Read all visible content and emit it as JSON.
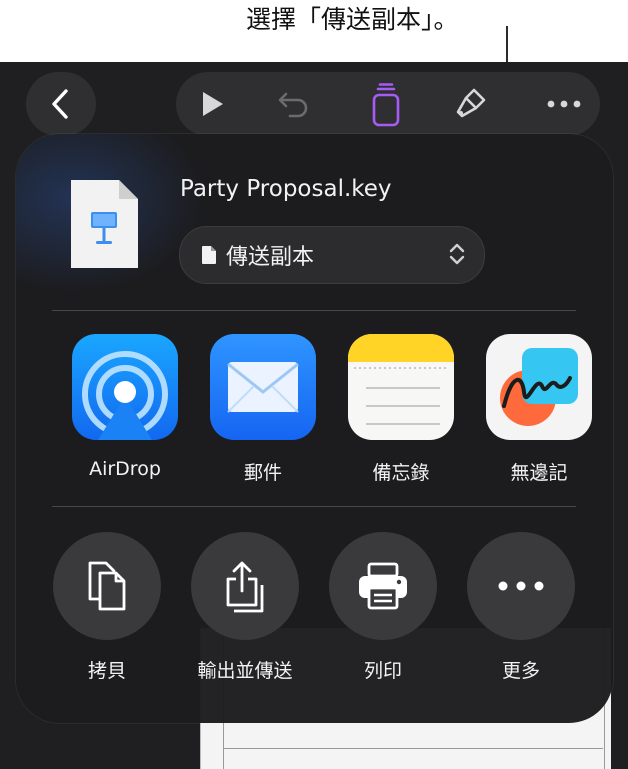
{
  "callout": {
    "text": "選擇「傳送副本」。"
  },
  "toolbar": {
    "icons": [
      "back-icon",
      "play-icon",
      "undo-icon",
      "collaborate-icon",
      "format-brush-icon",
      "more-icon"
    ],
    "accent_color": "#a45cf5"
  },
  "share_sheet": {
    "file_name": "Party Proposal.key",
    "send_option": {
      "label": "傳送副本"
    },
    "apps": [
      {
        "label": "AirDrop",
        "icon": "airdrop-icon"
      },
      {
        "label": "郵件",
        "icon": "mail-icon"
      },
      {
        "label": "備忘錄",
        "icon": "notes-icon"
      },
      {
        "label": "無邊記",
        "icon": "freeform-icon"
      }
    ],
    "actions": [
      {
        "label": "拷貝",
        "icon": "copy-icon"
      },
      {
        "label": "輸出並傳送",
        "icon": "export-icon"
      },
      {
        "label": "列印",
        "icon": "print-icon"
      },
      {
        "label": "更多",
        "icon": "more-icon"
      }
    ]
  }
}
